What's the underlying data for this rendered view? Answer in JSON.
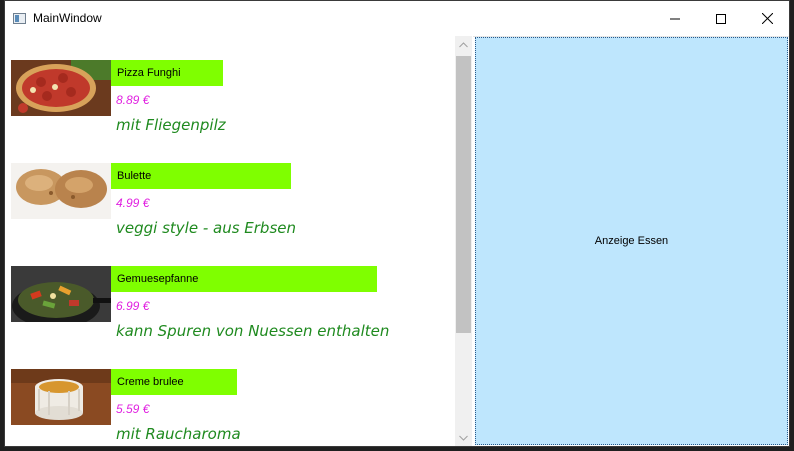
{
  "window": {
    "title": "MainWindow"
  },
  "menu_items": [
    {
      "name": "Pizza Funghi",
      "price": "8.89 €",
      "description": "mit Fliegenpilz",
      "image": "pizza-image"
    },
    {
      "name": "Bulette",
      "price": "4.99 €",
      "description": "veggi style - aus Erbsen",
      "image": "meatball-image"
    },
    {
      "name": "Gemuesepfanne",
      "price": "6.99 €",
      "description": "kann Spuren von Nuessen enthalten",
      "image": "vegetable-pan-image"
    },
    {
      "name": "Creme brulee",
      "price": "5.59 €",
      "description": "mit Raucharoma",
      "image": "creme-brulee-image"
    }
  ],
  "detail": {
    "label": "Anzeige Essen"
  },
  "colors": {
    "name_background": "#7fff00",
    "price_text": "#e020e0",
    "description_text": "#1f8a1f",
    "detail_background": "#bee6fd"
  }
}
